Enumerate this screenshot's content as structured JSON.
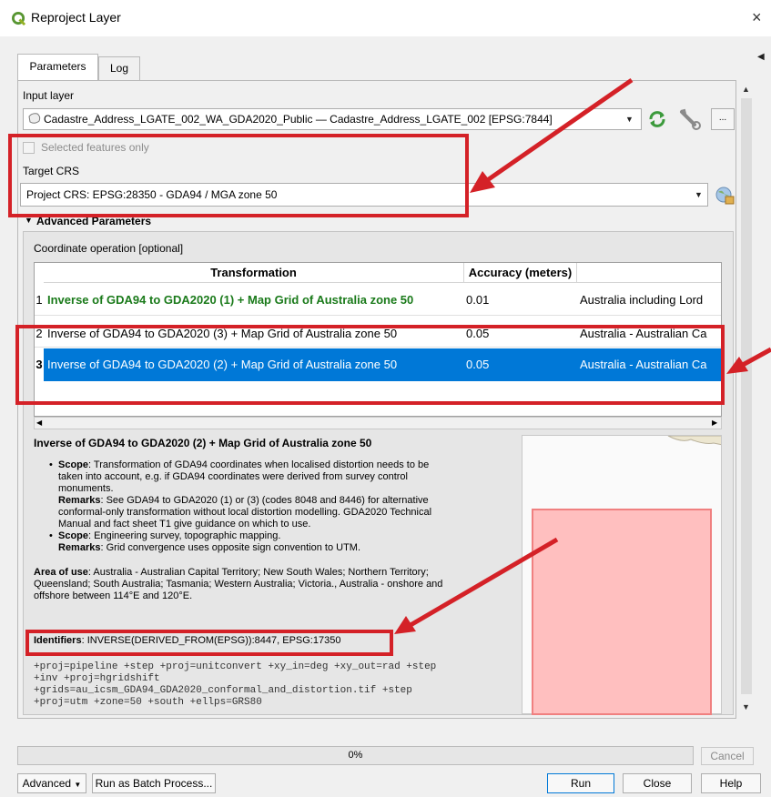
{
  "window": {
    "title": "Reproject Layer",
    "close_glyph": "×"
  },
  "tabs": [
    {
      "label": "Parameters"
    },
    {
      "label": "Log"
    }
  ],
  "input_layer": {
    "label": "Input layer",
    "value": "Cadastre_Address_LGATE_002_WA_GDA2020_Public — Cadastre_Address_LGATE_002 [EPSG:7844]",
    "more_button": "..."
  },
  "selected_features": {
    "label": "Selected features only",
    "checked": false
  },
  "target_crs": {
    "label": "Target CRS",
    "value": "Project CRS: EPSG:28350 - GDA94 / MGA zone 50"
  },
  "advanced": {
    "header": "Advanced Parameters",
    "coord_op_label": "Coordinate operation [optional]",
    "table": {
      "columns": [
        "Transformation",
        "Accuracy (meters)",
        ""
      ],
      "rows": [
        {
          "num": "1",
          "transformation": "Inverse of GDA94 to GDA2020 (1) + Map Grid of Australia zone 50",
          "accuracy": "0.01",
          "area": "Australia including Lord",
          "style": "preferred"
        },
        {
          "num": "2",
          "transformation": "Inverse of GDA94 to GDA2020 (3) + Map Grid of Australia zone 50",
          "accuracy": "0.05",
          "area": "Australia - Australian Ca",
          "style": "normal"
        },
        {
          "num": "3",
          "transformation": "Inverse of GDA94 to GDA2020 (2) + Map Grid of Australia zone 50",
          "accuracy": "0.05",
          "area": "Australia - Australian Ca",
          "style": "selected"
        }
      ]
    },
    "detail": {
      "title": "Inverse of GDA94 to GDA2020 (2) + Map Grid of Australia zone 50",
      "scope1_label": "Scope",
      "scope1_text": ": Transformation of GDA94 coordinates when localised distortion needs to be",
      "scope1_cont1": "taken into account, e.g. if GDA94 coordinates were derived from survey control",
      "scope1_cont2": "monuments.",
      "remarks1_label": "Remarks",
      "remarks1_text": ": See GDA94 to GDA2020 (1) or (3) (codes 8048 and 8446) for alternative",
      "remarks1_cont1": "conformal-only transformation without local distortion modelling. GDA2020 Technical",
      "remarks1_cont2": "Manual and fact sheet T1 give guidance on which to use.",
      "scope2_label": "Scope",
      "scope2_text": ": Engineering survey, topographic mapping.",
      "remarks2_label": "Remarks",
      "remarks2_text": ": Grid convergence uses opposite sign convention to UTM.",
      "area_label": "Area of use",
      "area_line1": ": Australia - Australian Capital Territory; New South Wales; Northern Territory;",
      "area_line2": "Queensland; South Australia; Tasmania; Western Australia; Victoria., Australia - onshore and",
      "area_line3": "offshore between 114°E and 120°E.",
      "identifiers_label": "Identifiers",
      "identifiers_text": ": INVERSE(DERIVED_FROM(EPSG)):8447, EPSG:17350",
      "proj_line1": "+proj=pipeline +step +proj=unitconvert +xy_in=deg +xy_out=rad +step",
      "proj_line2": "+inv +proj=hgridshift",
      "proj_line3": "+grids=au_icsm_GDA94_GDA2020_conformal_and_distortion.tif +step",
      "proj_line4": "+proj=utm +zone=50 +south +ellps=GRS80"
    }
  },
  "progress": {
    "text": "0%",
    "value": 0
  },
  "buttons": {
    "cancel": "Cancel",
    "advanced": "Advanced",
    "batch": "Run as Batch Process...",
    "run": "Run",
    "close": "Close",
    "help": "Help"
  },
  "colors": {
    "annotation_red": "#d42127",
    "selection_blue": "#0078d7",
    "preferred_green": "#1a7a1a",
    "extent_fill": "#ffbfbf"
  },
  "icons": [
    "qgis-logo-icon",
    "layer-icon",
    "iterate-icon",
    "wrench-icon",
    "globe-icon",
    "chevron-down-icon",
    "triangle-down-icon"
  ]
}
